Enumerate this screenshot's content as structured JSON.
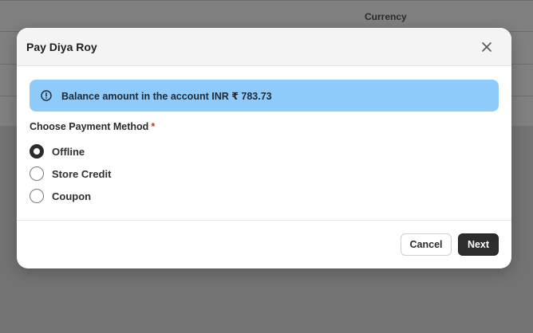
{
  "background": {
    "column_header": "Currency"
  },
  "modal": {
    "title": "Pay Diya Roy",
    "alert_text": "Balance amount in the account INR ₹ 783.73",
    "section_label": "Choose Payment Method",
    "required_mark": "*",
    "options": [
      {
        "label": "Offline",
        "selected": true
      },
      {
        "label": "Store Credit",
        "selected": false
      },
      {
        "label": "Coupon",
        "selected": false
      }
    ],
    "buttons": {
      "cancel": "Cancel",
      "next": "Next"
    }
  },
  "colors": {
    "alert_bg": "#8ecbfb",
    "primary_button": "#2d2d2d",
    "required": "#c0392b"
  }
}
